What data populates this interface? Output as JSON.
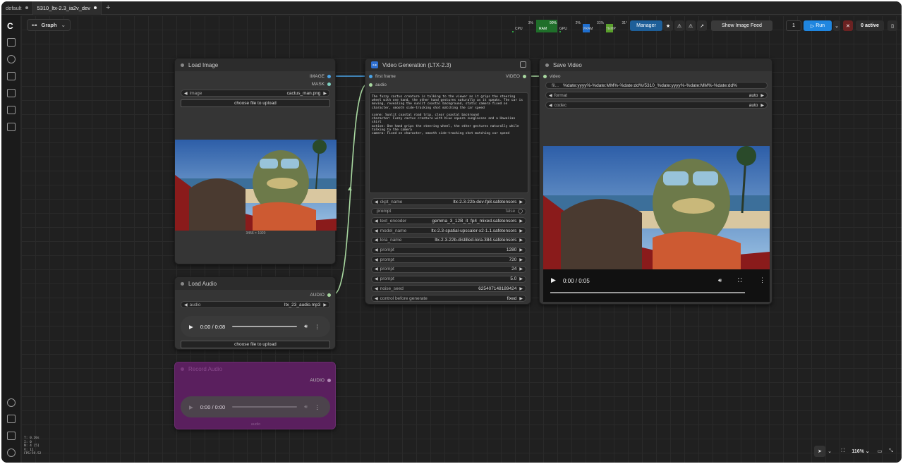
{
  "tabs": [
    {
      "label": "default"
    },
    {
      "label": "5310_ltx-2.3_ia2v_dev"
    }
  ],
  "toolbar": {
    "graph_label": "Graph",
    "cpu_pct": "3%",
    "cpu_label": "CPU",
    "ram_pct": "90%",
    "ram_label": "RAM",
    "gpu_pct": "2%",
    "gpu_label": "GPU",
    "vram_pct": "31%",
    "vram_label": "VRAM",
    "temp": "31°",
    "temp_label": "TEMP",
    "manager_label": "Manager",
    "image_feed_label": "Show Image Feed",
    "queue_count": "1",
    "run_label": "Run",
    "active_label": "0 active"
  },
  "nodes": {
    "load_image": {
      "title": "Load Image",
      "out_image": "IMAGE",
      "out_mask": "MASK",
      "image_label": "image",
      "image_value": "cactus_man.png",
      "upload_label": "choose file to upload",
      "dims": "3456 × 1920"
    },
    "load_audio": {
      "title": "Load Audio",
      "out_audio": "AUDIO",
      "audio_label": "audio",
      "audio_value": "ltx_23_audio.mp3",
      "time": "0:00 / 0:08",
      "upload_label": "choose file to upload"
    },
    "record_audio": {
      "title": "Record Audio",
      "out_audio": "AUDIO",
      "time": "0:00 / 0:00",
      "footer": "audio"
    },
    "video_gen": {
      "title": "Video Generation (LTX-2.3)",
      "in_first_frame": "first frame",
      "in_audio": "audio",
      "out_video": "VIDEO",
      "prompt_text": "The fuzzy cactus creature is talking to the viewer as it grips the steering wheel with one hand, the other hand gestures naturally as it speaks. The car is moving, revealing the sunlit coastal background, static camera fixed on character, smooth side-tracking shot matching the car speed\n\nscene: Sunlit coastal road trip, clear coastal backround\ncharacter: Fuzzy cactus creature with blue square sunglasses and a Hawaiian shirt\naction: One hand grips the steering wheel, the other gestures naturally while talking to the camera\ncamera: Fixed on character, smooth side-tracking shot matching car speed",
      "widgets": [
        {
          "label": "ckpt_name",
          "value": "ltx-2.3-22b-dev-fp8.safetensors"
        },
        {
          "label": "prompt",
          "value": "false"
        },
        {
          "label": "text_encoder",
          "value": "gemma_3_12B_it_fp4_mixed.safetensors"
        },
        {
          "label": "model_name",
          "value": "ltx-2.3-spatial-upscaler-x2-1.1.safetensors"
        },
        {
          "label": "lora_name",
          "value": "ltx-2.3-22b-distilled-lora-384.safetensors"
        },
        {
          "label": "prompt",
          "value": "1280"
        },
        {
          "label": "prompt",
          "value": "720"
        },
        {
          "label": "prompt",
          "value": "24"
        },
        {
          "label": "prompt",
          "value": "5.0"
        },
        {
          "label": "noise_seed",
          "value": "625407148189424"
        },
        {
          "label": "control before generate",
          "value": "fixed"
        }
      ]
    },
    "save_video": {
      "title": "Save Video",
      "in_video": "video",
      "prefix_label": "fil...",
      "prefix_value": "%date:yyyy%-%date:MM%-%date:dd%/5310_%date:yyyy%-%date:MM%-%date:dd%",
      "format_label": "format",
      "format_value": "auto",
      "codec_label": "codec",
      "codec_value": "auto",
      "time": "0:00 / 0:05"
    }
  },
  "status": [
    "T: 0.20s",
    "I: 0",
    "N: 4 [5]",
    "V: 11",
    "FPS:59.52"
  ],
  "bottom": {
    "zoom": "116%"
  }
}
